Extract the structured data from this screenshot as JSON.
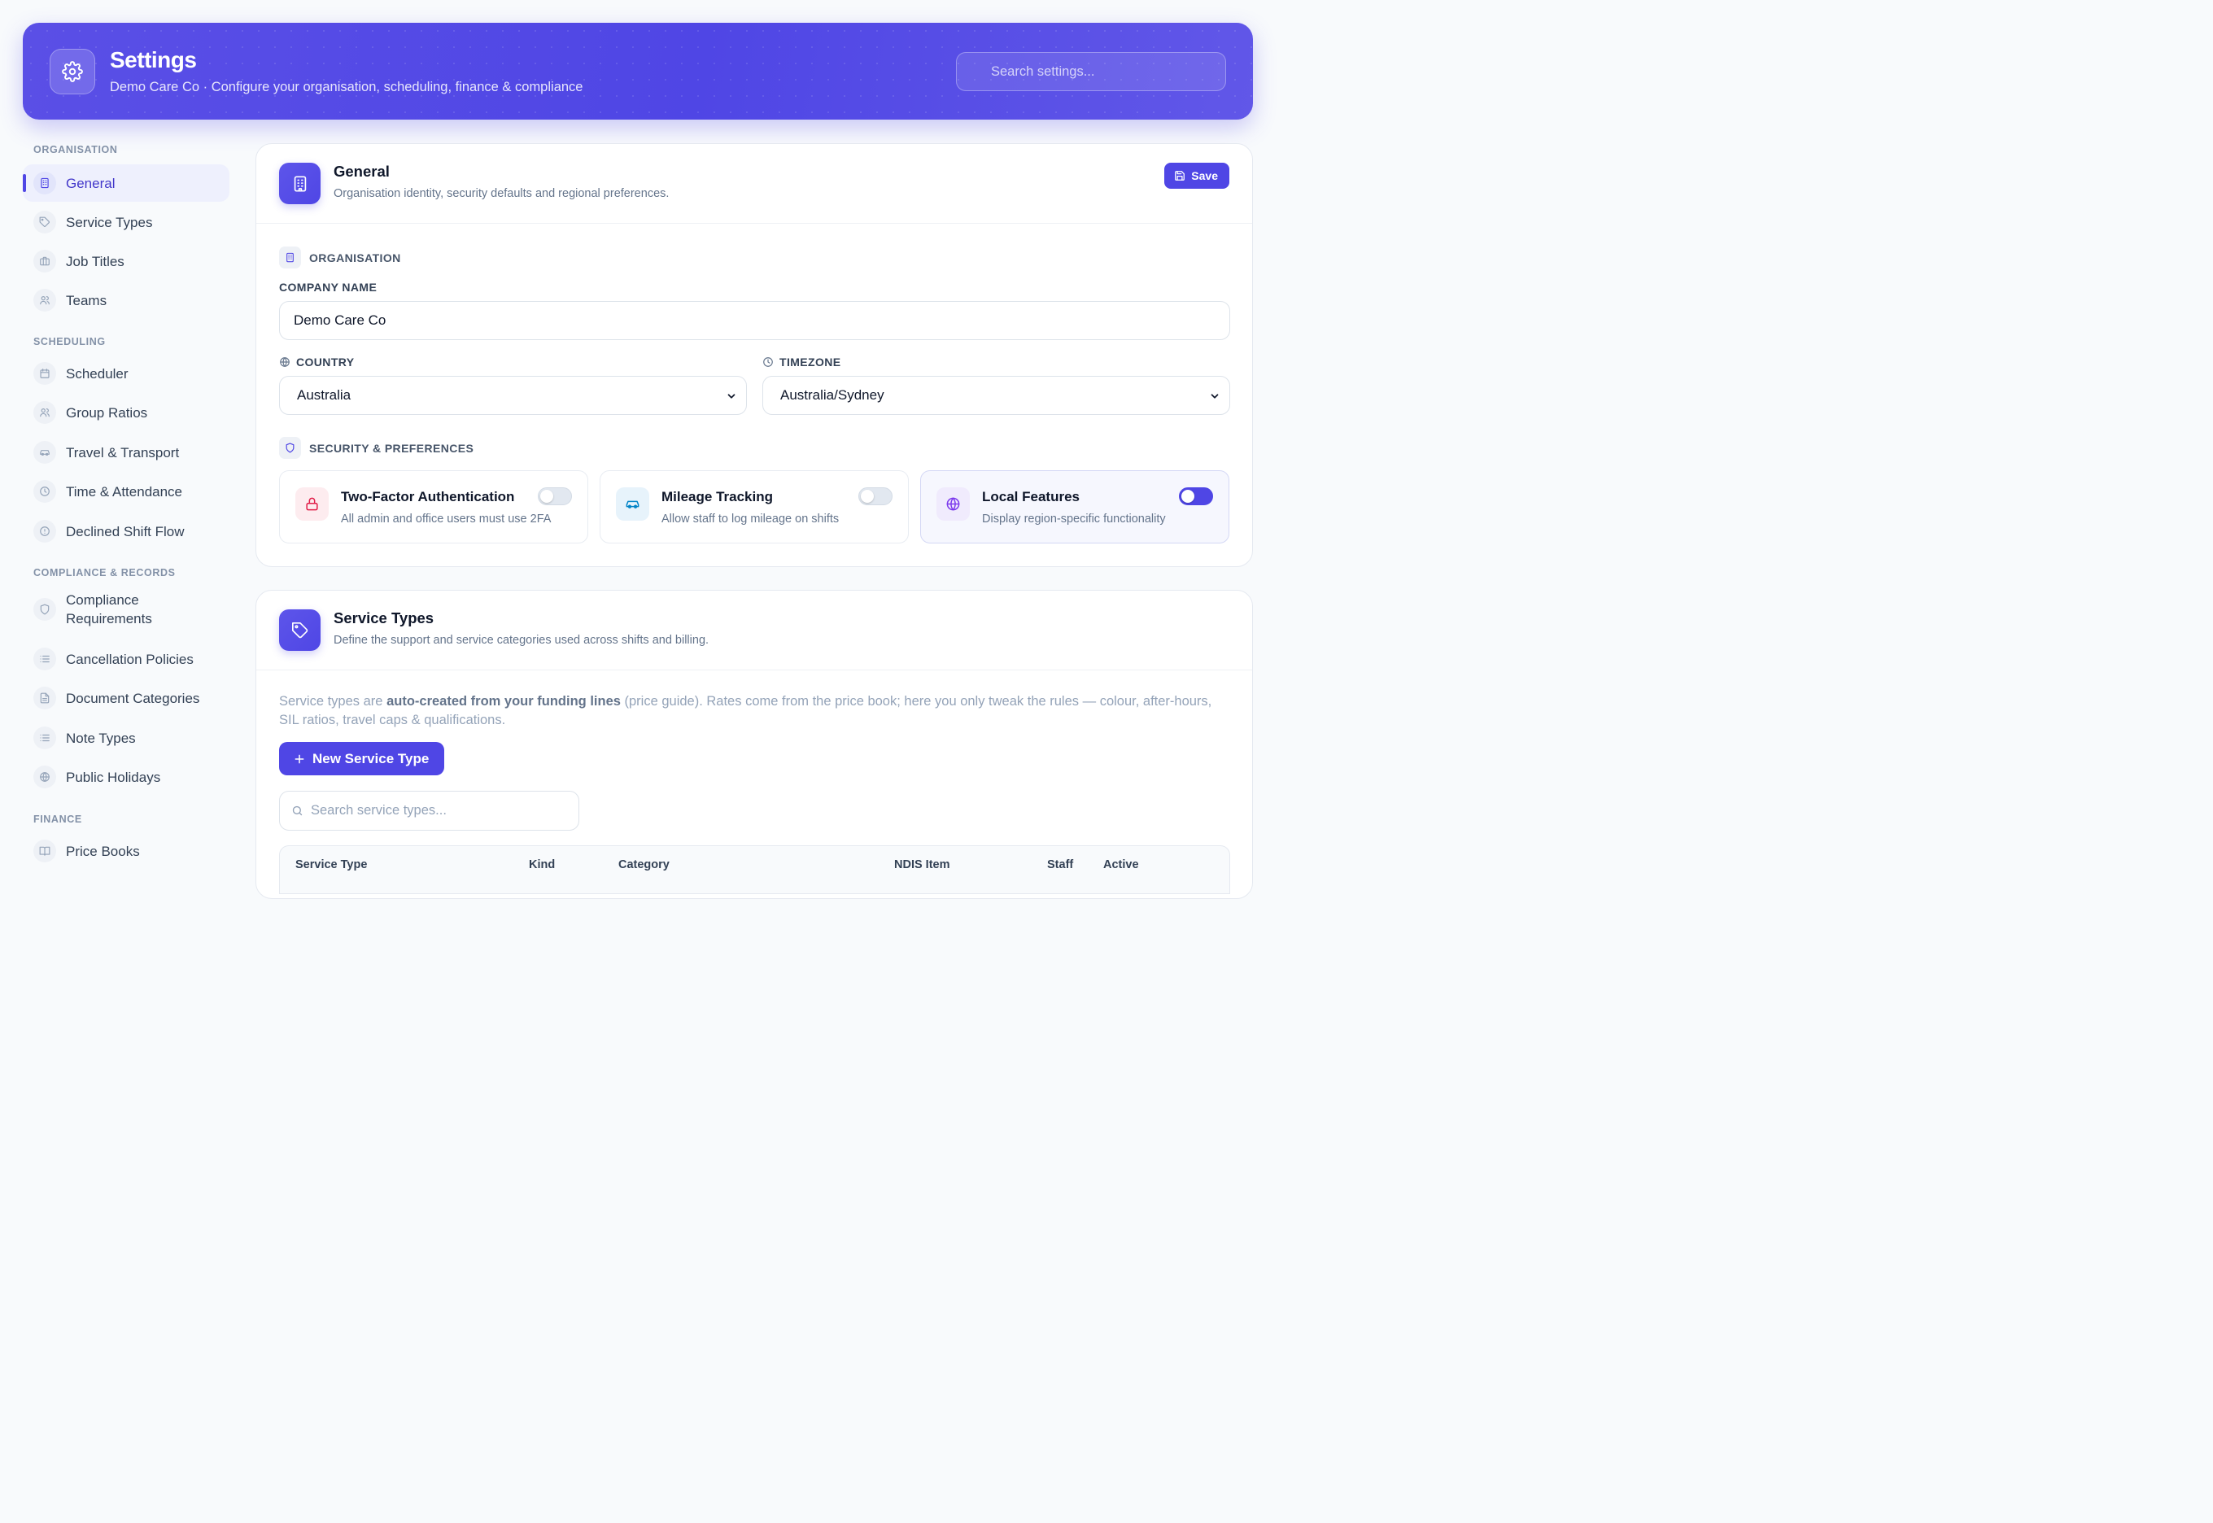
{
  "header": {
    "title": "Settings",
    "subtitle": "Demo Care Co · Configure your organisation, scheduling, finance & compliance",
    "search_placeholder": "Search settings..."
  },
  "sidebar": {
    "sections": [
      {
        "label": "ORGANISATION",
        "items": [
          {
            "label": "General",
            "icon": "building-icon",
            "active": true
          },
          {
            "label": "Service Types",
            "icon": "tag-icon"
          },
          {
            "label": "Job Titles",
            "icon": "briefcase-icon"
          },
          {
            "label": "Teams",
            "icon": "users-icon"
          }
        ]
      },
      {
        "label": "SCHEDULING",
        "items": [
          {
            "label": "Scheduler",
            "icon": "calendar-icon"
          },
          {
            "label": "Group Ratios",
            "icon": "users-icon"
          },
          {
            "label": "Travel & Transport",
            "icon": "car-icon"
          },
          {
            "label": "Time & Attendance",
            "icon": "clock-icon"
          },
          {
            "label": "Declined Shift Flow",
            "icon": "alert-circle-icon"
          }
        ]
      },
      {
        "label": "COMPLIANCE & RECORDS",
        "items": [
          {
            "label": "Compliance Requirements",
            "icon": "shield-icon"
          },
          {
            "label": "Cancellation Policies",
            "icon": "list-icon"
          },
          {
            "label": "Document Categories",
            "icon": "file-icon"
          },
          {
            "label": "Note Types",
            "icon": "list-icon"
          },
          {
            "label": "Public Holidays",
            "icon": "globe-icon"
          }
        ]
      },
      {
        "label": "FINANCE",
        "items": [
          {
            "label": "Price Books",
            "icon": "book-icon"
          }
        ]
      }
    ]
  },
  "general": {
    "title": "General",
    "description": "Organisation identity, security defaults and regional preferences.",
    "save_label": "Save",
    "org_section": "ORGANISATION",
    "company_label": "COMPANY NAME",
    "company_value": "Demo Care Co",
    "country_label": "COUNTRY",
    "country_value": "Australia",
    "timezone_label": "TIMEZONE",
    "timezone_value": "Australia/Sydney",
    "security_section": "SECURITY & PREFERENCES",
    "toggles": [
      {
        "title": "Two-Factor Authentication",
        "description": "All admin and office users must use 2FA",
        "on": false,
        "icon": "lock-icon",
        "color": "#e11d48"
      },
      {
        "title": "Mileage Tracking",
        "description": "Allow staff to log mileage on shifts",
        "on": false,
        "icon": "car-icon",
        "color": "#0284c7"
      },
      {
        "title": "Local Features",
        "description": "Display region-specific functionality",
        "on": true,
        "icon": "globe-icon",
        "color": "#7c3aed"
      }
    ]
  },
  "service_types": {
    "title": "Service Types",
    "description": "Define the support and service categories used across shifts and billing.",
    "info_prefix": "Service types are ",
    "info_bold": "auto-created from your funding lines",
    "info_suffix": " (price guide). Rates come from the price book; here you only tweak the rules — colour, after-hours, SIL ratios, travel caps & qualifications.",
    "new_button": "New Service Type",
    "search_placeholder": "Search service types...",
    "columns": [
      "Service Type",
      "Kind",
      "Category",
      "NDIS Item",
      "Staff",
      "Active"
    ]
  },
  "colors": {
    "accent": "#4f46e5",
    "accent_light": "#eef0fd"
  }
}
